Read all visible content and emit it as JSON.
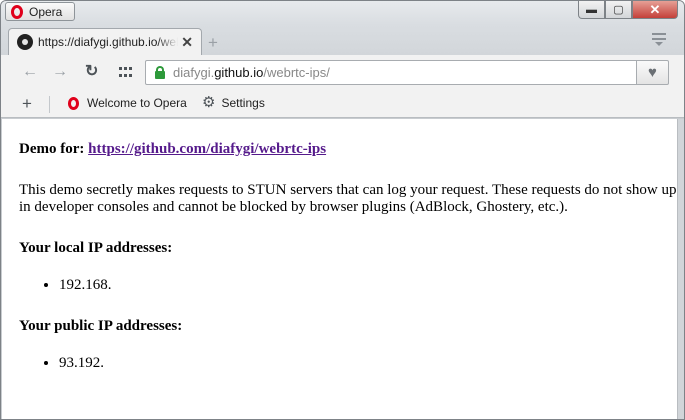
{
  "window": {
    "menu_label": "Opera",
    "controls": {
      "minimize": "▬",
      "maximize": "▢",
      "close": "✕"
    }
  },
  "tabs": [
    {
      "title": "https://diafygi.github.io/webrtc-ips/",
      "close": "✕",
      "favicon": "github-octocat-icon"
    }
  ],
  "tabstrip": {
    "new_tab": "+"
  },
  "toolbar": {
    "back": "←",
    "forward": "→",
    "reload": "↻",
    "url_host": "diafygi.github.io",
    "url_prefix": "diafygi.",
    "url_host_main": "github.io",
    "url_path": "/webrtc-ips/",
    "heart": "♥"
  },
  "bookmarks": {
    "add": "+",
    "items": [
      {
        "label": "Welcome to Opera",
        "icon": "opera-icon"
      },
      {
        "label": "Settings",
        "icon": "gear-icon"
      }
    ]
  },
  "page": {
    "demo_label": "Demo for:",
    "demo_link": "https://github.com/diafygi/webrtc-ips",
    "description": "This demo secretly makes requests to STUN servers that can log your request. These requests do not show up in developer consoles and cannot be blocked by browser plugins (AdBlock, Ghostery, etc.).",
    "local_heading": "Your local IP addresses:",
    "local_ips": [
      "192.168."
    ],
    "public_heading": "Your public IP addresses:",
    "public_ips": [
      "93.192."
    ]
  }
}
